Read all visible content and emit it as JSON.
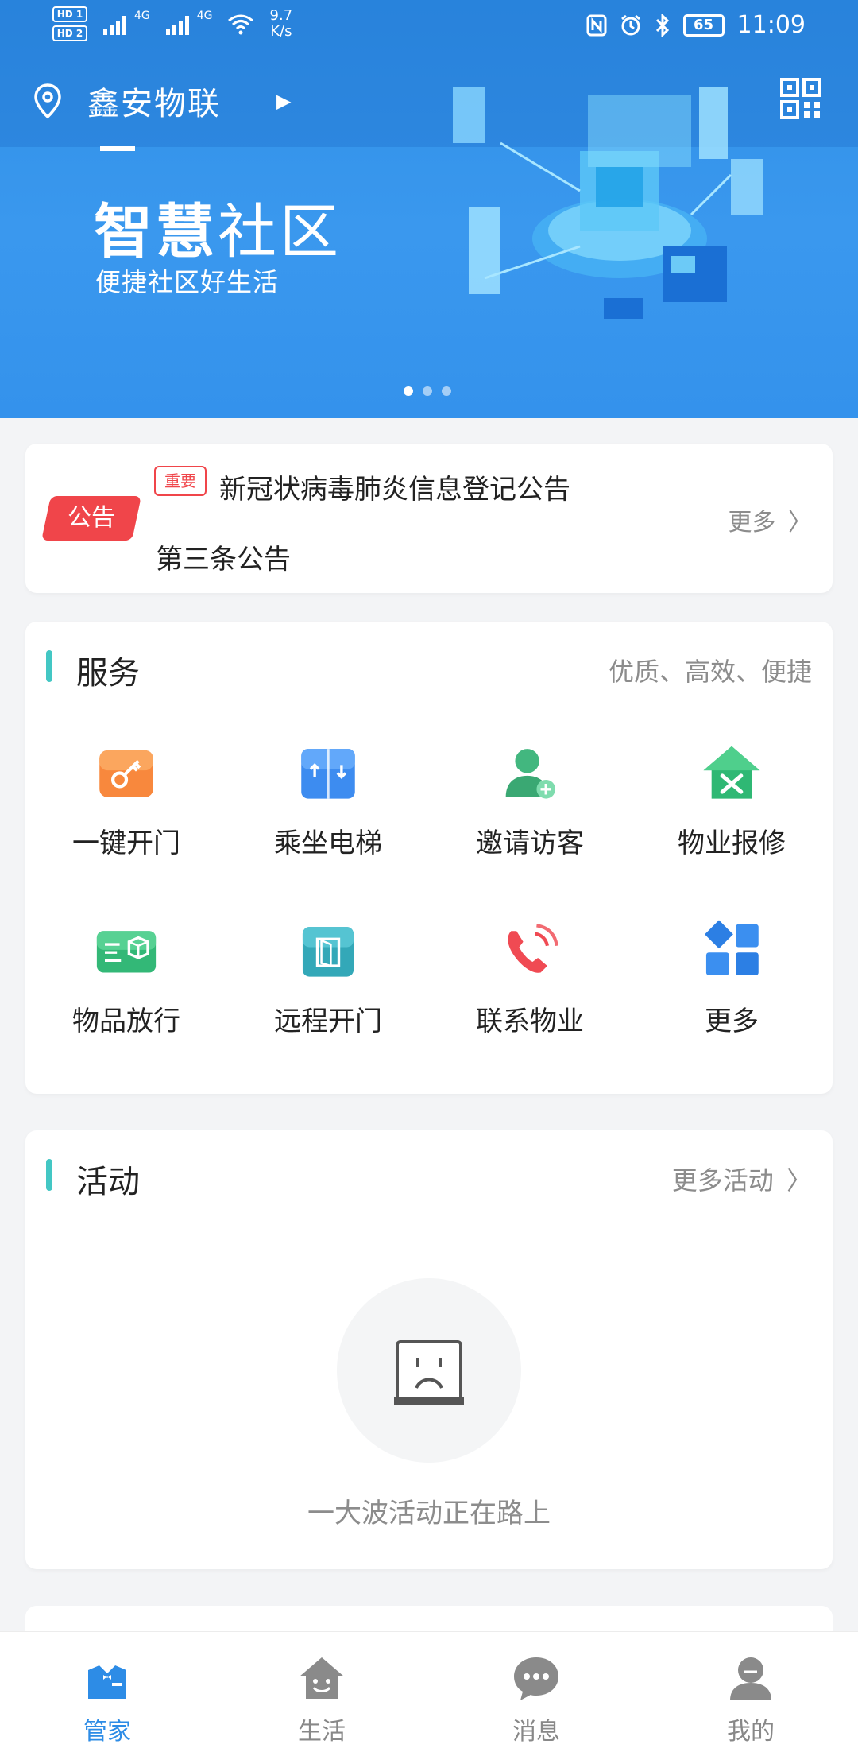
{
  "status_bar": {
    "sim1": "HD 1",
    "sim2": "HD 2",
    "net1": "4G",
    "net2": "4G",
    "speed_value": "9.7",
    "speed_unit": "K/s",
    "icons": [
      "nfc-icon",
      "alarm-icon",
      "bluetooth-icon"
    ],
    "battery": "65",
    "time": "11:09"
  },
  "header": {
    "location": "鑫安物联"
  },
  "banner": {
    "title_bold": "智慧",
    "title_rest": "社区",
    "subtitle": "便捷社区好生活",
    "dots": 3,
    "active_dot": 0
  },
  "notice": {
    "tag": "公告",
    "important_badge": "重要",
    "line1": "新冠状病毒肺炎信息登记公告",
    "line2": "第三条公告",
    "more": "更多"
  },
  "service": {
    "title": "服务",
    "slogan": "优质、高效、便捷",
    "items": [
      {
        "label": "一键开门",
        "icon": "key-icon"
      },
      {
        "label": "乘坐电梯",
        "icon": "elevator-icon"
      },
      {
        "label": "邀请访客",
        "icon": "invite-visitor-icon"
      },
      {
        "label": "物业报修",
        "icon": "repair-icon"
      },
      {
        "label": "物品放行",
        "icon": "package-release-icon"
      },
      {
        "label": "远程开门",
        "icon": "remote-door-icon"
      },
      {
        "label": "联系物业",
        "icon": "phone-icon"
      },
      {
        "label": "更多",
        "icon": "more-grid-icon"
      }
    ]
  },
  "activity": {
    "title": "活动",
    "more": "更多活动",
    "empty_text": "一大波活动正在路上"
  },
  "tabbar": {
    "tabs": [
      {
        "label": "管家",
        "icon": "butler-icon",
        "active": true
      },
      {
        "label": "生活",
        "icon": "house-face-icon",
        "active": false
      },
      {
        "label": "消息",
        "icon": "chat-icon",
        "active": false
      },
      {
        "label": "我的",
        "icon": "profile-icon",
        "active": false
      }
    ]
  },
  "colors": {
    "primary": "#2d8ce6",
    "accent_red": "#f0454a",
    "section_bar": "#43c7c4"
  }
}
